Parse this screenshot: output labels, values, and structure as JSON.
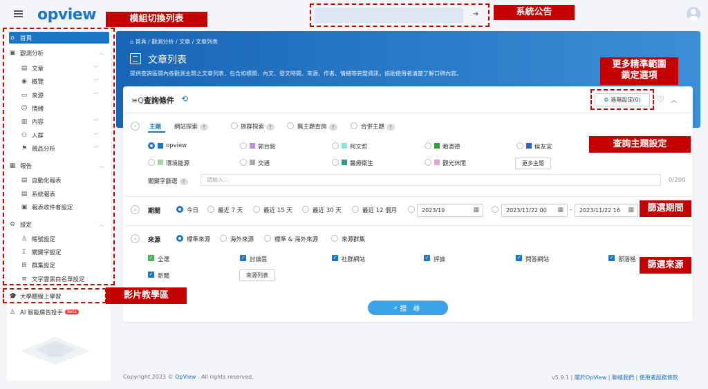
{
  "app": {
    "logo": "opview"
  },
  "callouts": {
    "module_switch": "模組切換列表",
    "announcement": "系統公告",
    "precise_scope": "更多精準範圍\n鎖定選項",
    "topic_setting": "查詢主題設定",
    "period_filter": "篩選期間",
    "source_filter": "篩選來源",
    "video_learning": "影片教學區"
  },
  "sidebar": {
    "home": "首頁",
    "analysis": "觀測分析",
    "analysis_items": [
      "文章",
      "概覽",
      "來源",
      "情緒",
      "內容",
      "人群",
      "競品分析"
    ],
    "report": "報告",
    "report_items": [
      "自動化報表",
      "系統報表",
      "報表收件者設定"
    ],
    "settings": "設定",
    "settings_items": [
      "帳號設定",
      "關鍵字設定",
      "群集設定",
      "文字雲黑白名單設定"
    ],
    "learning": "大學聽線上學習",
    "ai": "AI 智能廣告投手",
    "ai_badge": "Beta"
  },
  "hero": {
    "breadcrumb": [
      "首頁",
      "觀測分析",
      "文章",
      "文章列表"
    ],
    "title": "文章列表",
    "description": "提供查詢區間內各觀測主題之文章列表，包含如標題、內文、發文時間、來源、作者、情緒等完整資訊，協助使用者清楚了解口碑內容。"
  },
  "query": {
    "title": "查詢條件",
    "advanced_label": "進階設定(0)",
    "tabs": [
      "主題",
      "網站探索",
      "族群探索",
      "無主題查詢",
      "合併主題"
    ],
    "topics": [
      {
        "name": "opview",
        "color": "#1b75c9",
        "selected": true
      },
      {
        "name": "郭台銘",
        "color": "#c58be0",
        "selected": false
      },
      {
        "name": "柯文哲",
        "color": "#8ee3e6",
        "selected": false
      },
      {
        "name": "賴清德",
        "color": "#2e9e3a",
        "selected": false
      },
      {
        "name": "侯友宜",
        "color": "#2a5fd6",
        "selected": false
      },
      {
        "name": "環境能源",
        "color": "#9fd8a0",
        "selected": false
      },
      {
        "name": "交通",
        "color": "#aaaaaa",
        "selected": false
      },
      {
        "name": "醫療衛生",
        "color": "#2c9c8c",
        "selected": false
      },
      {
        "name": "觀光休閒",
        "color": "#e6a3d8",
        "selected": false
      }
    ],
    "more_topics": "更多主題",
    "keyword_label": "關鍵字篩選",
    "keyword_placeholder": "請輸入...",
    "keyword_count": "0/200",
    "period_label": "期間",
    "period_options": [
      "今日",
      "最近 7 天",
      "最近 15 天",
      "最近 30 天",
      "最近 12 個月"
    ],
    "month_value": "2023/10",
    "range_start": "2023/11/22 00",
    "range_sep": "-",
    "range_end": "2023/11/22 16",
    "source_label": "來源",
    "source_options": [
      "標準來源",
      "海外來源",
      "標準 & 海外來源",
      "來源群集"
    ],
    "source_checks": [
      "全選",
      "討論區",
      "社群網站",
      "評論",
      "問答網站",
      "部落格",
      "新聞"
    ],
    "source_list_btn": "來源列表",
    "search_btn": "搜 尋"
  },
  "footer": {
    "copyright_pre": "Copyright 2023 ©",
    "copyright_brand": "OpView",
    "copyright_post": ". All rights reserved.",
    "version": "v5.9.1",
    "links": [
      "關於OpView",
      "聯絡我們",
      "使用者服務條款"
    ]
  }
}
